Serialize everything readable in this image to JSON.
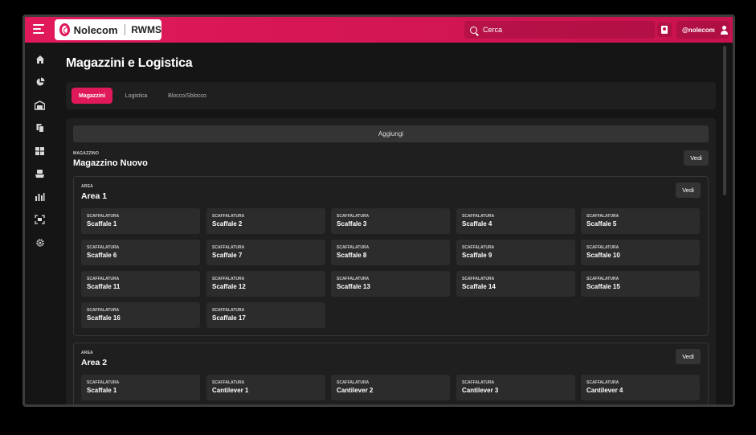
{
  "header": {
    "brand": "Nolecom",
    "app": "RWMS",
    "search_placeholder": "Cerca",
    "user": "@nolecom"
  },
  "sidebar": {
    "items": [
      "home-icon",
      "pie-chart-icon",
      "warehouse-icon",
      "documents-icon",
      "boxes-icon",
      "delivery-icon",
      "stats-icon",
      "scan-icon",
      "settings-icon"
    ]
  },
  "main": {
    "title": "Magazzini e Logistica",
    "tabs": [
      {
        "label": "Magazzini",
        "active": true
      },
      {
        "label": "Logistica",
        "active": false
      },
      {
        "label": "Blocco/Sblocco",
        "active": false
      }
    ],
    "add_label": "Aggiungi",
    "warehouse": {
      "category": "MAGAZZINO",
      "name": "Magazzino Nuovo",
      "vedi": "Vedi"
    },
    "areas": [
      {
        "category": "AREA",
        "name": "Area 1",
        "vedi": "Vedi",
        "racks": [
          {
            "cat": "SCAFFALATURA",
            "name": "Scaffale 1"
          },
          {
            "cat": "SCAFFALATURA",
            "name": "Scaffale 2"
          },
          {
            "cat": "SCAFFALATURA",
            "name": "Scaffale 3"
          },
          {
            "cat": "SCAFFALATURA",
            "name": "Scaffale 4"
          },
          {
            "cat": "SCAFFALATURA",
            "name": "Scaffale 5"
          },
          {
            "cat": "SCAFFALATURA",
            "name": "Scaffale 6"
          },
          {
            "cat": "SCAFFALATURA",
            "name": "Scaffale 7"
          },
          {
            "cat": "SCAFFALATURA",
            "name": "Scaffale 8"
          },
          {
            "cat": "SCAFFALATURA",
            "name": "Scaffale 9"
          },
          {
            "cat": "SCAFFALATURA",
            "name": "Scaffale 10"
          },
          {
            "cat": "SCAFFALATURA",
            "name": "Scaffale 11"
          },
          {
            "cat": "SCAFFALATURA",
            "name": "Scaffale 12"
          },
          {
            "cat": "SCAFFALATURA",
            "name": "Scaffale 13"
          },
          {
            "cat": "SCAFFALATURA",
            "name": "Scaffale 14"
          },
          {
            "cat": "SCAFFALATURA",
            "name": "Scaffale 15"
          },
          {
            "cat": "SCAFFALATURA",
            "name": "Scaffale 16"
          },
          {
            "cat": "SCAFFALATURA",
            "name": "Scaffale 17"
          }
        ]
      },
      {
        "category": "AREA",
        "name": "Area 2",
        "vedi": "Vedi",
        "racks": [
          {
            "cat": "SCAFFALATURA",
            "name": "Scaffale 1"
          },
          {
            "cat": "SCAFFALATURA",
            "name": "Cantilever 1"
          },
          {
            "cat": "SCAFFALATURA",
            "name": "Cantilever 2"
          },
          {
            "cat": "SCAFFALATURA",
            "name": "Cantilever 3"
          },
          {
            "cat": "SCAFFALATURA",
            "name": "Cantilever 4"
          }
        ]
      }
    ]
  },
  "colors": {
    "accent": "#e0195a",
    "background": "#151515",
    "panel": "#1f1f1f",
    "card": "#2c2c2c"
  }
}
